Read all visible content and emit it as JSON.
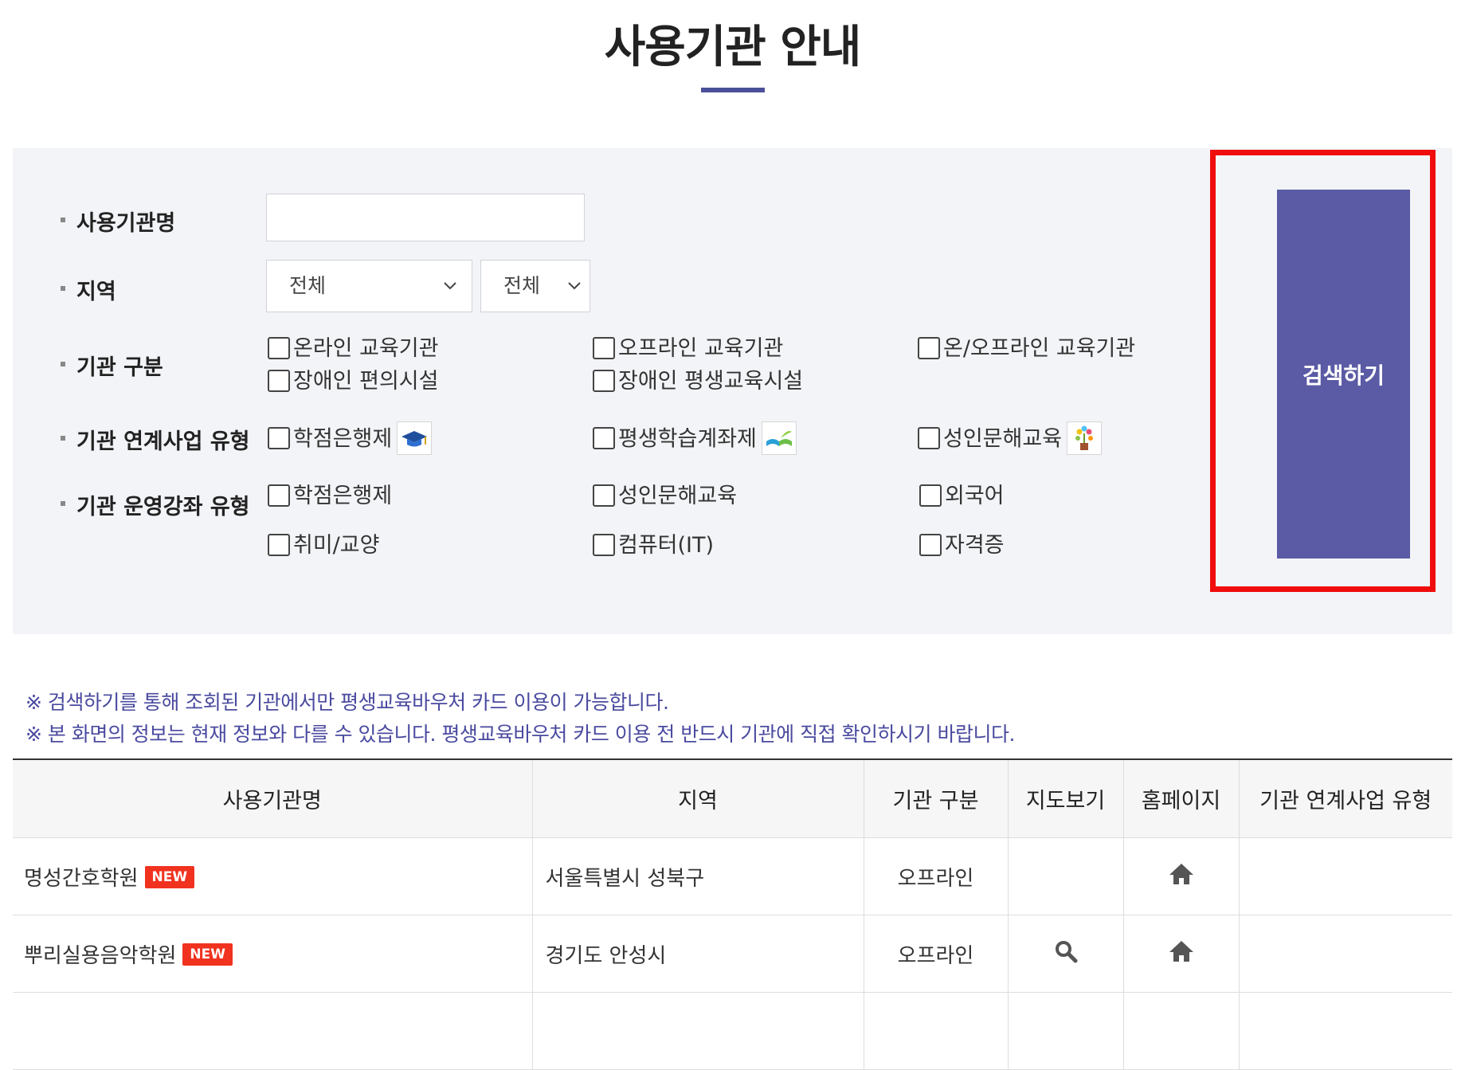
{
  "page": {
    "title": "사용기관 안내"
  },
  "filters": {
    "name_label": "사용기관명",
    "name_value": "",
    "region_label": "지역",
    "region_select_1": "전체",
    "region_select_2": "전체",
    "type_label": "기관 구분",
    "type_options": [
      "온라인 교육기관",
      "오프라인 교육기관",
      "온/오프라인 교육기관",
      "장애인 편의시설",
      "장애인 평생교육시설"
    ],
    "linked_label": "기관 연계사업 유형",
    "linked_options": [
      "학점은행제",
      "평생학습계좌제",
      "성인문해교육"
    ],
    "course_label": "기관 운영강좌 유형",
    "course_options": [
      "학점은행제",
      "성인문해교육",
      "외국어",
      "취미/교양",
      "컴퓨터(IT)",
      "자격증"
    ],
    "search_button": "검색하기"
  },
  "notices": [
    "※ 검색하기를 통해 조회된 기관에서만 평생교육바우처 카드 이용이 가능합니다.",
    "※ 본 화면의 정보는 현재 정보와 다를 수 있습니다. 평생교육바우처 카드 이용 전 반드시 기관에 직접 확인하시기 바랍니다."
  ],
  "table": {
    "headers": [
      "사용기관명",
      "지역",
      "기관 구분",
      "지도보기",
      "홈페이지",
      "기관 연계사업 유형"
    ],
    "new_badge": "NEW",
    "rows": [
      {
        "name": "명성간호학원",
        "region": "서울특별시 성북구",
        "type": "오프라인",
        "map": false,
        "homepage": true
      },
      {
        "name": "뿌리실용음악학원",
        "region": "경기도 안성시",
        "type": "오프라인",
        "map": true,
        "homepage": true
      }
    ]
  },
  "colors": {
    "accent": "#5a5aa5",
    "highlight": "#f00d0d",
    "notice_text": "#4a4aa0",
    "new_badge": "#f0321f"
  },
  "icons": [
    "chevron-down-icon",
    "graduation-cap-icon",
    "open-book-icon",
    "plant-pot-icon",
    "magnifier-icon",
    "home-icon"
  ]
}
